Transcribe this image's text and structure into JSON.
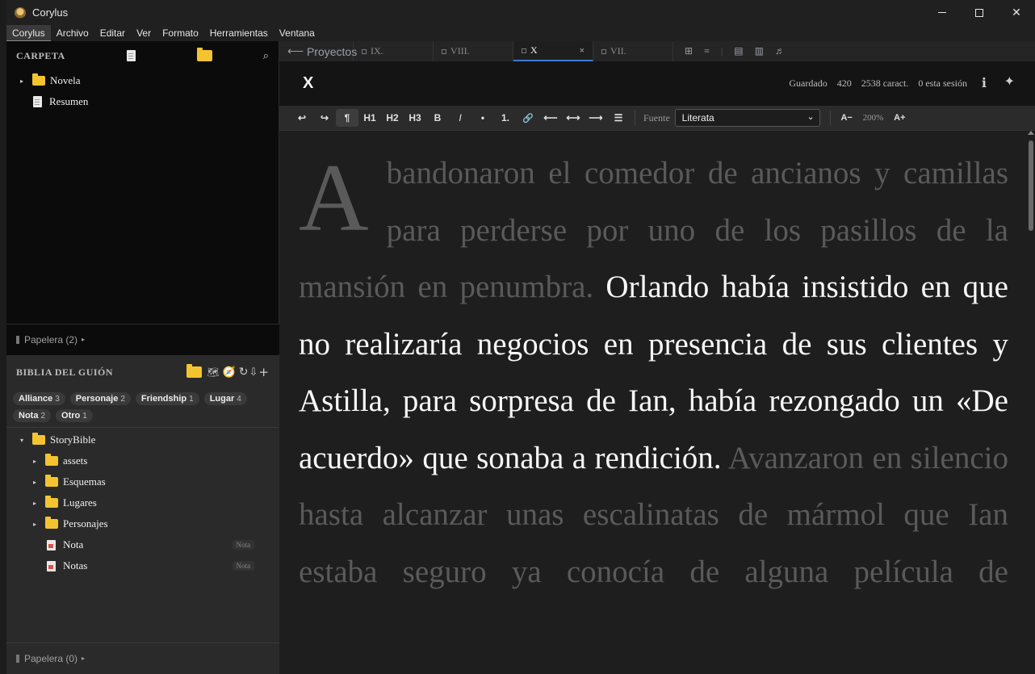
{
  "window": {
    "title": "Corylus"
  },
  "menu": [
    "Corylus",
    "Archivo",
    "Editar",
    "Ver",
    "Formato",
    "Herramientas",
    "Ventana"
  ],
  "left_panel": {
    "title": "CARPETA",
    "items": [
      {
        "label": "Novela",
        "type": "folder"
      },
      {
        "label": "Resumen",
        "type": "doc"
      }
    ],
    "trash": "Papelera (2)"
  },
  "story_bible": {
    "title": "BIBLIA DEL GUIÓN",
    "tags": [
      {
        "name": "Alliance",
        "count": "3"
      },
      {
        "name": "Personaje",
        "count": "2"
      },
      {
        "name": "Friendship",
        "count": "1"
      },
      {
        "name": "Lugar",
        "count": "4"
      },
      {
        "name": "Nota",
        "count": "2"
      },
      {
        "name": "Otro",
        "count": "1"
      }
    ],
    "tree": {
      "root": "StoryBible",
      "folders": [
        "assets",
        "Esquemas",
        "Lugares",
        "Personajes"
      ],
      "notes": [
        {
          "label": "Nota",
          "badge": "Nota"
        },
        {
          "label": "Notas",
          "badge": "Nota"
        }
      ]
    },
    "trash": "Papelera (0)"
  },
  "tabs": {
    "back": "Proyectos",
    "items": [
      "IX.",
      "VIII.",
      "X",
      "VII."
    ],
    "active": "X"
  },
  "document": {
    "title": "X",
    "status": "Guardado",
    "words": "420",
    "chars": "2538 caract.",
    "session": "0 esta sesión"
  },
  "format_bar": {
    "buttons": [
      "↩",
      "↪",
      "¶",
      "H1",
      "H2",
      "H3",
      "B",
      "I",
      "•",
      "1.",
      "🔗",
      "⟵",
      "⟷",
      "⟶",
      "☰"
    ],
    "font_label": "Fuente",
    "font_value": "Literata",
    "zoom": "200%",
    "zoom_out": "A−",
    "zoom_in": "A+"
  },
  "prose": {
    "drop_cap": "A",
    "dim_1": "bandonaron el comedor de ancianos y camillas para perderse por uno de los pasillos de la mansión en penumbra.",
    "bright": "Orlando había insistido en que no realizaría negocios en presencia de sus clientes y Astilla, para sorpresa de Ian, había rezongado un «De acuerdo» que sonaba a rendición.",
    "dim_2": "Avanzaron en silencio hasta alcanzar unas escalinatas de mármol que Ian estaba seguro ya conocía de alguna película de"
  }
}
